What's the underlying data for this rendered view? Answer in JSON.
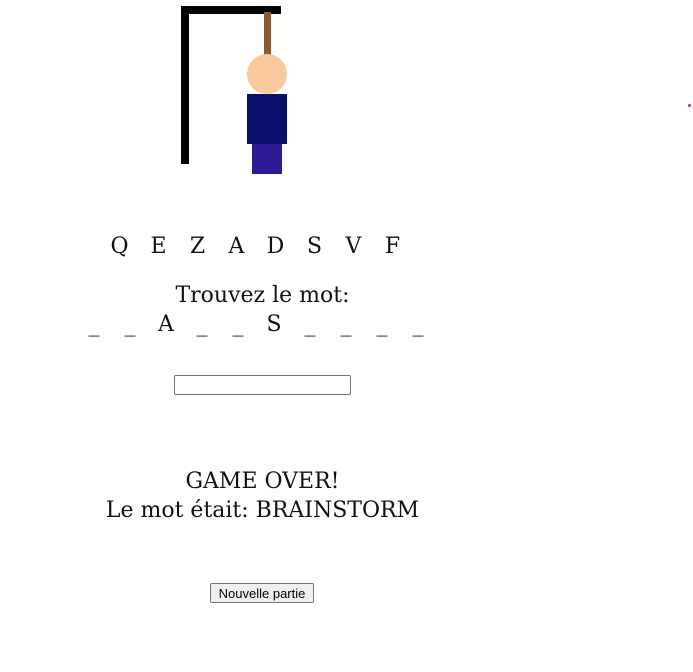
{
  "colors": {
    "gallows": "#000000",
    "rope": "#8b5a2b",
    "head": "#f8c99c",
    "torso": "#0a0f6b",
    "legs": "#2e1a96",
    "dot": "#d9342b"
  },
  "used_letters": [
    "Q",
    "E",
    "Z",
    "A",
    "D",
    "S",
    "V",
    "F"
  ],
  "prompt": "Trouvez le mot:",
  "word": [
    "_",
    "_",
    "A",
    "_",
    "_",
    "S",
    "_",
    "_",
    "_",
    "_"
  ],
  "guess_input": {
    "value": "",
    "placeholder": ""
  },
  "result": {
    "headline": "GAME OVER!",
    "answer": "Le mot était: BRAINSTORM"
  },
  "new_game_label": "Nouvelle partie"
}
